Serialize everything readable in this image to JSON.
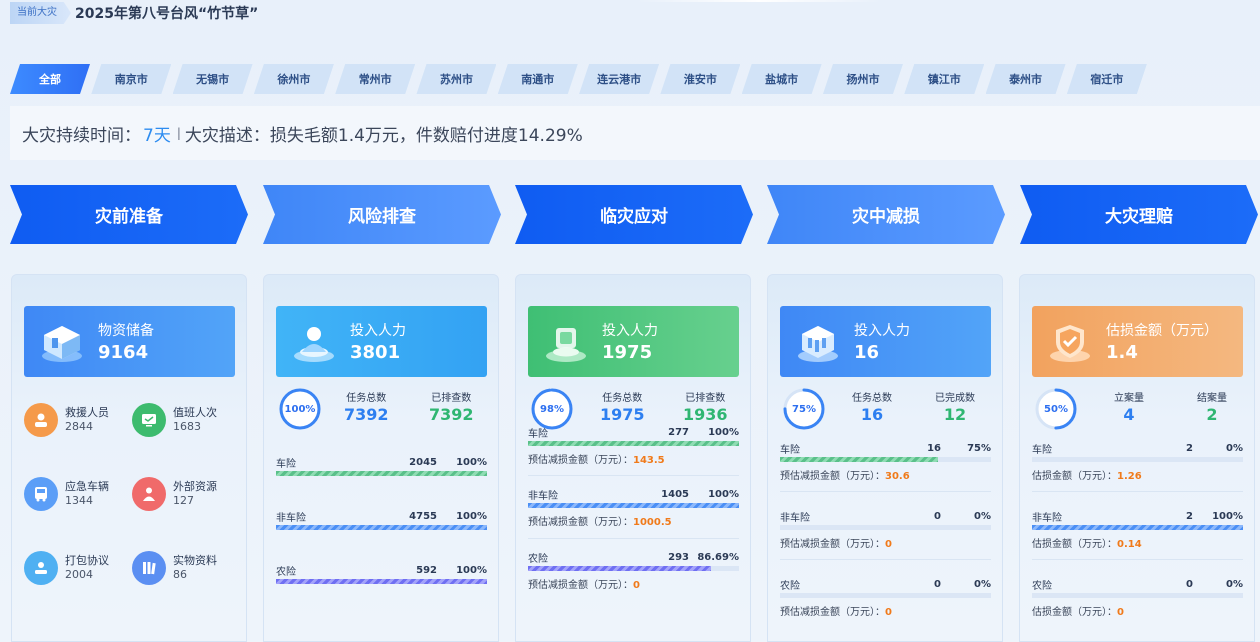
{
  "header": {
    "current_tag": "当前大灾",
    "title": "2025年第八号台风“竹节草”"
  },
  "tabs": [
    "全部",
    "南京市",
    "无锡市",
    "徐州市",
    "常州市",
    "苏州市",
    "南通市",
    "连云港市",
    "淮安市",
    "盐城市",
    "扬州市",
    "镇江市",
    "泰州市",
    "宿迁市"
  ],
  "active_tab": 0,
  "info": {
    "duration_label": "大灾持续时间：",
    "duration_value": "7天",
    "separator": "|",
    "desc_label": "大灾描述：",
    "desc_value": "损失毛额1.4万元，件数赔付进度14.29%"
  },
  "stages": [
    "灾前准备",
    "风险排查",
    "临灾应对",
    "灾中减损",
    "大灾理赔"
  ],
  "card1": {
    "hero": {
      "label": "物资储备",
      "value": "9164",
      "icon": "warehouse-icon"
    },
    "items": [
      {
        "label": "救援人员",
        "value": "2844",
        "icon": "rescuer-icon",
        "color": "#f59a4a"
      },
      {
        "label": "值班人次",
        "value": "1683",
        "icon": "monitor-icon",
        "color": "#3dbb6e"
      },
      {
        "label": "应急车辆",
        "value": "1344",
        "icon": "bus-icon",
        "color": "#5b9ef7"
      },
      {
        "label": "外部资源",
        "value": "127",
        "icon": "person-icon",
        "color": "#f06a6a"
      },
      {
        "label": "打包协议",
        "value": "2004",
        "icon": "agreement-icon",
        "color": "#4fb0f2"
      },
      {
        "label": "实物资料",
        "value": "86",
        "icon": "books-icon",
        "color": "#5b8ff2"
      }
    ]
  },
  "card2": {
    "hero": {
      "label": "投入人力",
      "value": "3801",
      "icon": "staff-icon"
    },
    "ring": {
      "text": "100%",
      "value": 1.0
    },
    "stats": [
      {
        "label": "任务总数",
        "value": "7392"
      },
      {
        "label": "已排查数",
        "value": "7392"
      }
    ],
    "bars": [
      {
        "name": "车险",
        "num": "2045",
        "pct": "100%",
        "fill": 1.0,
        "style": "green"
      },
      {
        "name": "非车险",
        "num": "4755",
        "pct": "100%",
        "fill": 1.0,
        "style": "blue"
      },
      {
        "name": "农险",
        "num": "592",
        "pct": "100%",
        "fill": 1.0,
        "style": "purple"
      }
    ]
  },
  "card3": {
    "hero": {
      "label": "投入人力",
      "value": "1975",
      "icon": "response-icon"
    },
    "ring": {
      "text": "98%",
      "value": 0.98
    },
    "stats": [
      {
        "label": "任务总数",
        "value": "1975"
      },
      {
        "label": "已排查数",
        "value": "1936"
      }
    ],
    "est_label": "预估减损金额（万元）：",
    "bars": [
      {
        "name": "车险",
        "num": "277",
        "pct": "100%",
        "fill": 1.0,
        "style": "green",
        "est": "143.5"
      },
      {
        "name": "非车险",
        "num": "1405",
        "pct": "100%",
        "fill": 1.0,
        "style": "blue",
        "est": "1000.5"
      },
      {
        "name": "农险",
        "num": "293",
        "pct": "86.69%",
        "fill": 0.8669,
        "style": "purple",
        "est": "0"
      }
    ]
  },
  "card4": {
    "hero": {
      "label": "投入人力",
      "value": "16",
      "icon": "building-icon"
    },
    "ring": {
      "text": "75%",
      "value": 0.75
    },
    "stats": [
      {
        "label": "任务总数",
        "value": "16"
      },
      {
        "label": "已完成数",
        "value": "12"
      }
    ],
    "est_label": "预估减损金额（万元）：",
    "bars": [
      {
        "name": "车险",
        "num": "16",
        "pct": "75%",
        "fill": 0.75,
        "style": "green",
        "est": "30.6"
      },
      {
        "name": "非车险",
        "num": "0",
        "pct": "0%",
        "fill": 0,
        "style": "blue",
        "est": "0"
      },
      {
        "name": "农险",
        "num": "0",
        "pct": "0%",
        "fill": 0,
        "style": "purple",
        "est": "0"
      }
    ]
  },
  "card5": {
    "hero": {
      "label": "估损金额（万元）",
      "value": "1.4",
      "icon": "shield-check-icon"
    },
    "ring": {
      "text": "50%",
      "value": 0.5
    },
    "stats": [
      {
        "label": "立案量",
        "value": "4"
      },
      {
        "label": "结案量",
        "value": "2"
      }
    ],
    "est_label": "估损金额（万元）：",
    "bars": [
      {
        "name": "车险",
        "num": "2",
        "pct": "0%",
        "fill": 0,
        "style": "green",
        "est": "1.26"
      },
      {
        "name": "非车险",
        "num": "2",
        "pct": "100%",
        "fill": 1.0,
        "style": "blue",
        "est": "0.14"
      },
      {
        "name": "农险",
        "num": "0",
        "pct": "0%",
        "fill": 0,
        "style": "purple",
        "est": "0"
      }
    ]
  }
}
